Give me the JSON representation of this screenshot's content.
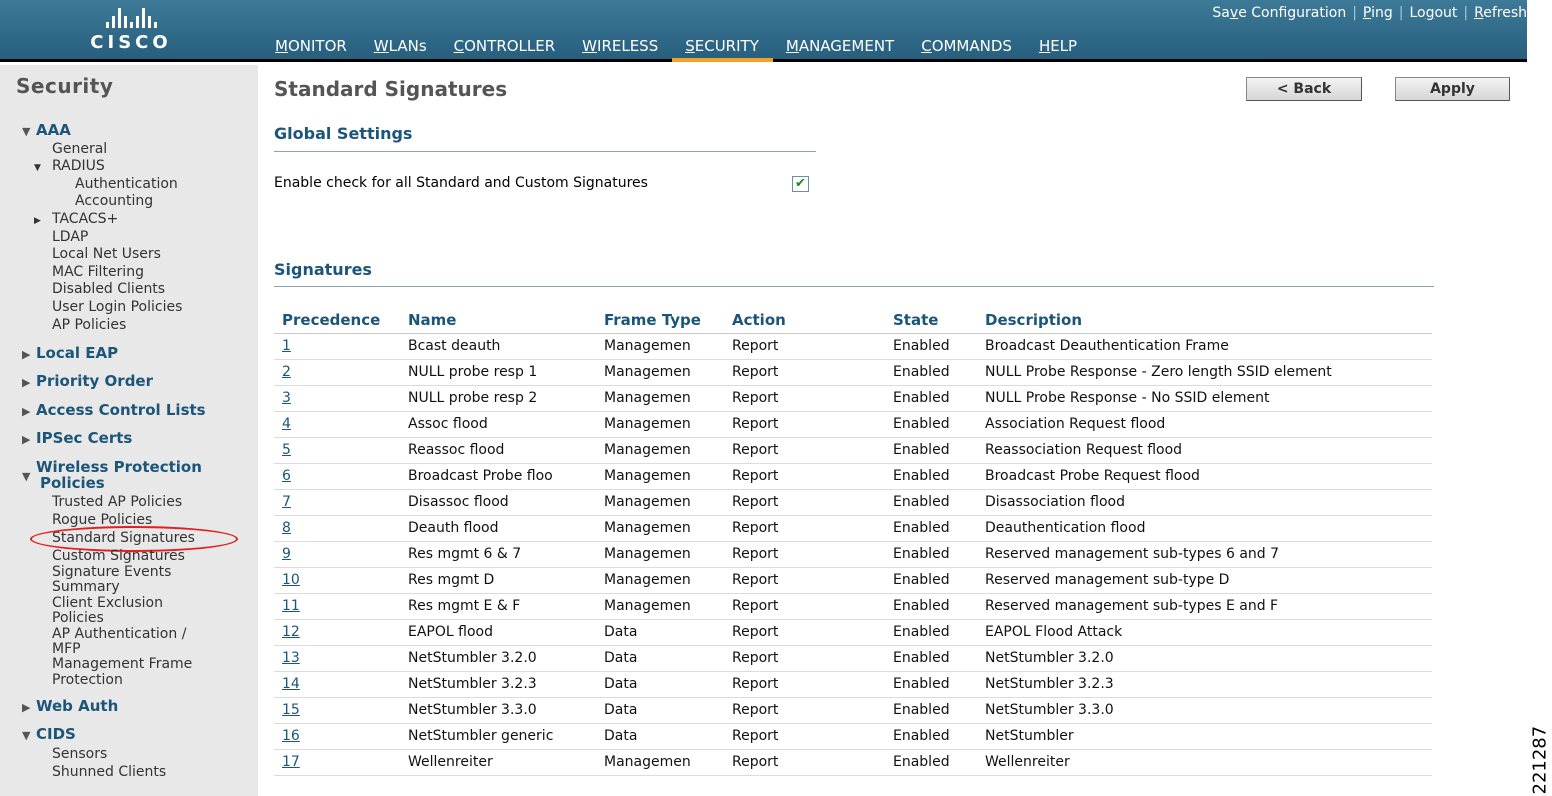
{
  "header": {
    "logo_text": "CISCO",
    "top_links": [
      {
        "label": "Save Configuration",
        "key_index": 2
      },
      {
        "label": "Ping",
        "key_index": 0
      },
      {
        "label": "Logout",
        "key_index": 2
      },
      {
        "label": "Refresh",
        "key_index": 0
      }
    ],
    "nav": [
      {
        "label": "MONITOR",
        "active": false
      },
      {
        "label": "WLANs",
        "active": false
      },
      {
        "label": "CONTROLLER",
        "active": false
      },
      {
        "label": "WIRELESS",
        "active": false
      },
      {
        "label": "SECURITY",
        "active": true
      },
      {
        "label": "MANAGEMENT",
        "active": false
      },
      {
        "label": "COMMANDS",
        "active": false
      },
      {
        "label": "HELP",
        "active": false
      }
    ]
  },
  "sidebar": {
    "title": "Security",
    "aaa": "AAA",
    "aaa_items": [
      "General"
    ],
    "radius": "RADIUS",
    "radius_items": [
      "Authentication",
      "Accounting"
    ],
    "tacacs": "TACACS+",
    "aaa_items2": [
      "LDAP",
      "Local Net Users",
      "MAC Filtering",
      "Disabled Clients",
      "User Login Policies",
      "AP Policies"
    ],
    "local_eap": "Local EAP",
    "priority_order": "Priority Order",
    "acl": "Access Control Lists",
    "ipsec": "IPSec Certs",
    "wpp_line1": "Wireless Protection",
    "wpp_line2": "Policies",
    "wpp_items": [
      "Trusted AP Policies",
      "Rogue Policies",
      "Standard Signatures",
      "Custom Signatures",
      "Signature Events",
      "Summary",
      "Client Exclusion",
      "Policies",
      "AP Authentication /",
      "MFP",
      "Management Frame",
      "Protection"
    ],
    "web_auth": "Web Auth",
    "cids": "CIDS",
    "cids_items": [
      "Sensors",
      "Shunned Clients"
    ]
  },
  "main": {
    "title": "Standard Signatures",
    "back_label": "< Back",
    "apply_label": "Apply",
    "global_settings": "Global Settings",
    "enable_check_label": "Enable check for all Standard and Custom Signatures",
    "enable_check_checked": true,
    "signatures_heading": "Signatures",
    "columns": [
      "Precedence",
      "Name",
      "Frame Type",
      "Action",
      "State",
      "Description"
    ],
    "rows": [
      [
        "1",
        "Bcast deauth",
        "Managemen",
        "Report",
        "Enabled",
        "Broadcast Deauthentication Frame"
      ],
      [
        "2",
        "NULL probe resp 1",
        "Managemen",
        "Report",
        "Enabled",
        "NULL Probe Response - Zero length SSID element"
      ],
      [
        "3",
        "NULL probe resp 2",
        "Managemen",
        "Report",
        "Enabled",
        "NULL Probe Response - No SSID element"
      ],
      [
        "4",
        "Assoc flood",
        "Managemen",
        "Report",
        "Enabled",
        "Association Request flood"
      ],
      [
        "5",
        "Reassoc flood",
        "Managemen",
        "Report",
        "Enabled",
        "Reassociation Request flood"
      ],
      [
        "6",
        "Broadcast Probe floo",
        "Managemen",
        "Report",
        "Enabled",
        "Broadcast Probe Request flood"
      ],
      [
        "7",
        "Disassoc flood",
        "Managemen",
        "Report",
        "Enabled",
        "Disassociation flood"
      ],
      [
        "8",
        "Deauth flood",
        "Managemen",
        "Report",
        "Enabled",
        "Deauthentication flood"
      ],
      [
        "9",
        "Res mgmt 6 & 7",
        "Managemen",
        "Report",
        "Enabled",
        "Reserved management sub-types 6 and 7"
      ],
      [
        "10",
        "Res mgmt D",
        "Managemen",
        "Report",
        "Enabled",
        "Reserved management sub-type D"
      ],
      [
        "11",
        "Res mgmt E & F",
        "Managemen",
        "Report",
        "Enabled",
        "Reserved management sub-types E and F"
      ],
      [
        "12",
        "EAPOL flood",
        "Data",
        "Report",
        "Enabled",
        "EAPOL Flood Attack"
      ],
      [
        "13",
        "NetStumbler 3.2.0",
        "Data",
        "Report",
        "Enabled",
        "NetStumbler 3.2.0"
      ],
      [
        "14",
        "NetStumbler 3.2.3",
        "Data",
        "Report",
        "Enabled",
        "NetStumbler 3.2.3"
      ],
      [
        "15",
        "NetStumbler 3.3.0",
        "Data",
        "Report",
        "Enabled",
        "NetStumbler 3.3.0"
      ],
      [
        "16",
        "NetStumbler generic",
        "Data",
        "Report",
        "Enabled",
        "NetStumbler"
      ],
      [
        "17",
        "Wellenreiter",
        "Managemen",
        "Report",
        "Enabled",
        "Wellenreiter"
      ]
    ]
  },
  "figure_id": "221287",
  "colors": {
    "header_top": "#3d7a98",
    "header_bottom": "#275f7d",
    "accent": "#f3a12a",
    "heading": "#1b5579",
    "sidebar_bg": "#e8e8e8",
    "highlight": "#e02020"
  }
}
